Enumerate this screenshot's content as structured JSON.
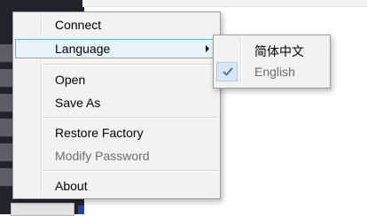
{
  "main_menu": {
    "items": [
      {
        "label": "Connect",
        "enabled": true
      },
      {
        "label": "Language",
        "enabled": true,
        "has_submenu": true,
        "highlighted": true
      },
      {
        "label": "Open",
        "enabled": true
      },
      {
        "label": "Save As",
        "enabled": true
      },
      {
        "label": "Restore Factory",
        "enabled": true
      },
      {
        "label": "Modify Password",
        "enabled": false
      },
      {
        "label": "About",
        "enabled": true
      }
    ]
  },
  "language_submenu": {
    "items": [
      {
        "label": "简体中文",
        "checked": false,
        "enabled": true
      },
      {
        "label": "English",
        "checked": true,
        "enabled": false
      }
    ]
  },
  "icons": {
    "submenu_arrow": "chevron-right-icon",
    "check": "check-icon"
  },
  "colors": {
    "menu_background": "#f2f2f2",
    "highlight_background": "#e7f2fb",
    "highlight_border": "#6bb2e0",
    "check_color": "#3c6fa8",
    "disabled_text": "#6d6d6d"
  }
}
